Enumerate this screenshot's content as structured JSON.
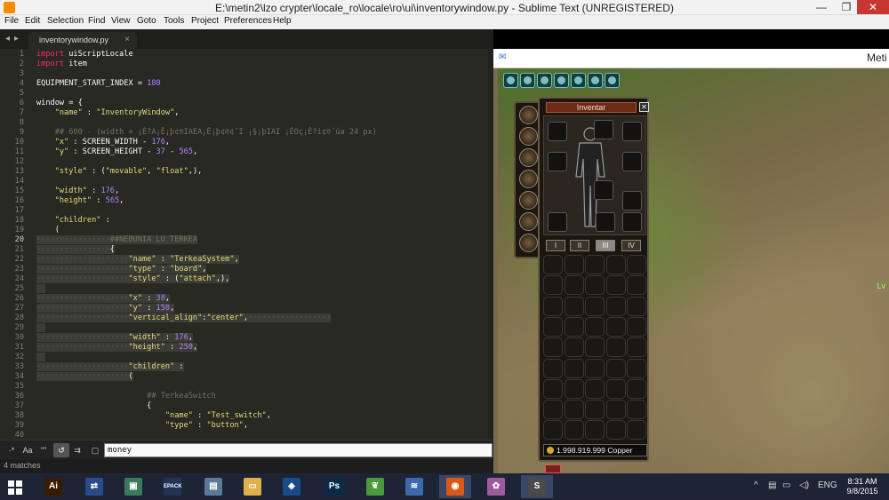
{
  "window": {
    "title": "E:\\metin2\\lzo crypter\\locale_ro\\locale\\ro\\ui\\inventorywindow.py - Sublime Text (UNREGISTERED)",
    "minimize": "—",
    "maximize": "❐",
    "close": "✕"
  },
  "menu": [
    "File",
    "Edit",
    "Selection",
    "Find",
    "View",
    "Goto",
    "Tools",
    "Project",
    "Preferences",
    "Help"
  ],
  "editor": {
    "tab_label": "inventorywindow.py",
    "tab_close": "×",
    "nav_back": "◂",
    "nav_fwd": "▸",
    "lines": [
      {
        "n": "1",
        "parts": [
          [
            "kw",
            "import"
          ],
          [
            "",
            " uiScriptLocale"
          ]
        ]
      },
      {
        "n": "2",
        "parts": [
          [
            "kw",
            "import"
          ],
          [
            "",
            " item"
          ]
        ]
      },
      {
        "n": "3",
        "parts": []
      },
      {
        "n": "4",
        "parts": [
          [
            "",
            "EQUIPMENT_START_INDEX = "
          ],
          [
            "num",
            "180"
          ]
        ]
      },
      {
        "n": "5",
        "parts": []
      },
      {
        "n": "6",
        "parts": [
          [
            "",
            "window = {"
          ]
        ]
      },
      {
        "n": "7",
        "parts": [
          [
            "",
            "    "
          ],
          [
            "str",
            "\"name\""
          ],
          [
            "",
            " : "
          ],
          [
            "str",
            "\"InventoryWindow\""
          ],
          [
            "",
            ","
          ]
        ]
      },
      {
        "n": "8",
        "parts": []
      },
      {
        "n": "9",
        "parts": [
          [
            "cm",
            "    ## 600 - (width + ¡È?A¡Ë¡þ¢®IAEA¡Ë¡þ¢®¢¯I ¡§¡þIAI ¡ÊOç¡Ê?í¢®´úa 24 px)"
          ]
        ]
      },
      {
        "n": "10",
        "parts": [
          [
            "",
            "    "
          ],
          [
            "str",
            "\"x\""
          ],
          [
            "",
            " : SCREEN_WIDTH - "
          ],
          [
            "num",
            "176"
          ],
          [
            "",
            ","
          ]
        ]
      },
      {
        "n": "11",
        "parts": [
          [
            "",
            "    "
          ],
          [
            "str",
            "\"y\""
          ],
          [
            "",
            " : SCREEN_HEIGHT - "
          ],
          [
            "num",
            "37"
          ],
          [
            "",
            " - "
          ],
          [
            "num",
            "565"
          ],
          [
            "",
            ","
          ]
        ]
      },
      {
        "n": "12",
        "parts": []
      },
      {
        "n": "13",
        "parts": [
          [
            "",
            "    "
          ],
          [
            "str",
            "\"style\""
          ],
          [
            "",
            " : ("
          ],
          [
            "str",
            "\"movable\""
          ],
          [
            "",
            ", "
          ],
          [
            "str",
            "\"float\""
          ],
          [
            "",
            ",),"
          ]
        ]
      },
      {
        "n": "14",
        "parts": []
      },
      {
        "n": "15",
        "parts": [
          [
            "",
            "    "
          ],
          [
            "str",
            "\"width\""
          ],
          [
            "",
            " : "
          ],
          [
            "num",
            "176"
          ],
          [
            "",
            ","
          ]
        ]
      },
      {
        "n": "16",
        "parts": [
          [
            "",
            "    "
          ],
          [
            "str",
            "\"height\""
          ],
          [
            "",
            " : "
          ],
          [
            "num",
            "565"
          ],
          [
            "",
            ","
          ]
        ]
      },
      {
        "n": "17",
        "parts": []
      },
      {
        "n": "18",
        "parts": [
          [
            "",
            "    "
          ],
          [
            "str",
            "\"children\""
          ],
          [
            "",
            " :"
          ]
        ]
      },
      {
        "n": "19",
        "parts": [
          [
            "",
            "    ("
          ]
        ]
      },
      {
        "n": "20",
        "hl": true,
        "parts": [
          [
            "dots",
            "················"
          ],
          [
            "cm",
            "##NEBUNIA LU TERKEA"
          ]
        ]
      },
      {
        "n": "21",
        "hl": true,
        "parts": [
          [
            "dots",
            "················"
          ],
          [
            "",
            "{"
          ]
        ]
      },
      {
        "n": "22",
        "hl": true,
        "parts": [
          [
            "dots",
            "····················"
          ],
          [
            "str",
            "\"name\""
          ],
          [
            "",
            " : "
          ],
          [
            "str",
            "\"TerkeaSystem\""
          ],
          [
            "",
            ","
          ]
        ]
      },
      {
        "n": "23",
        "hl": true,
        "parts": [
          [
            "dots",
            "····················"
          ],
          [
            "str",
            "\"type\""
          ],
          [
            "",
            " : "
          ],
          [
            "str",
            "\"board\""
          ],
          [
            "",
            ","
          ]
        ]
      },
      {
        "n": "24",
        "hl": true,
        "parts": [
          [
            "dots",
            "····················"
          ],
          [
            "str",
            "\"style\""
          ],
          [
            "",
            " : ("
          ],
          [
            "str",
            "\"attach\""
          ],
          [
            "",
            ",),"
          ]
        ]
      },
      {
        "n": "25",
        "hl": true,
        "parts": [
          [
            "",
            "  "
          ]
        ]
      },
      {
        "n": "26",
        "hl": true,
        "parts": [
          [
            "dots",
            "····················"
          ],
          [
            "str",
            "\"x\""
          ],
          [
            "",
            " : "
          ],
          [
            "num",
            "38"
          ],
          [
            "",
            ","
          ]
        ]
      },
      {
        "n": "27",
        "hl": true,
        "parts": [
          [
            "dots",
            "····················"
          ],
          [
            "str",
            "\"y\""
          ],
          [
            "",
            " : "
          ],
          [
            "num",
            "150"
          ],
          [
            "",
            ","
          ]
        ]
      },
      {
        "n": "28",
        "hl": true,
        "parts": [
          [
            "dots",
            "····················"
          ],
          [
            "str",
            "\"vertical_align\""
          ],
          [
            "",
            ":"
          ],
          [
            "str",
            "\"center\""
          ],
          [
            "",
            ","
          ],
          [
            "dots",
            "··················"
          ]
        ]
      },
      {
        "n": "29",
        "hl": true,
        "parts": [
          [
            "",
            "  "
          ]
        ]
      },
      {
        "n": "30",
        "hl": true,
        "parts": [
          [
            "dots",
            "····················"
          ],
          [
            "str",
            "\"width\""
          ],
          [
            "",
            " : "
          ],
          [
            "num",
            "176"
          ],
          [
            "",
            ","
          ]
        ]
      },
      {
        "n": "31",
        "hl": true,
        "parts": [
          [
            "dots",
            "····················"
          ],
          [
            "str",
            "\"height\""
          ],
          [
            "",
            " : "
          ],
          [
            "num",
            "250"
          ],
          [
            "",
            ","
          ]
        ]
      },
      {
        "n": "32",
        "hl": true,
        "parts": [
          [
            "",
            "  "
          ]
        ]
      },
      {
        "n": "33",
        "hl": true,
        "parts": [
          [
            "dots",
            "····················"
          ],
          [
            "str",
            "\"children\""
          ],
          [
            "",
            " :"
          ]
        ]
      },
      {
        "n": "34",
        "hl": true,
        "parts": [
          [
            "dots",
            "····················"
          ],
          [
            "",
            "("
          ]
        ]
      },
      {
        "n": "35",
        "parts": []
      },
      {
        "n": "36",
        "parts": [
          [
            "cm",
            "                        ## TerkeaSwitch"
          ]
        ]
      },
      {
        "n": "37",
        "parts": [
          [
            "",
            "                        {"
          ]
        ]
      },
      {
        "n": "38",
        "parts": [
          [
            "",
            "                            "
          ],
          [
            "str",
            "\"name\""
          ],
          [
            "",
            " : "
          ],
          [
            "str",
            "\"Test_switch\""
          ],
          [
            "",
            ","
          ]
        ]
      },
      {
        "n": "39",
        "parts": [
          [
            "",
            "                            "
          ],
          [
            "str",
            "\"type\""
          ],
          [
            "",
            " : "
          ],
          [
            "str",
            "\"button\""
          ],
          [
            "",
            ","
          ]
        ]
      },
      {
        "n": "40",
        "parts": []
      }
    ],
    "current_line": "20"
  },
  "find": {
    "options": [
      {
        "label": "·*",
        "on": false
      },
      {
        "label": "Aa",
        "on": false
      },
      {
        "label": "“”",
        "on": false
      },
      {
        "label": "↺",
        "on": true
      },
      {
        "label": "⇉",
        "on": false
      },
      {
        "label": "▢",
        "on": false
      }
    ],
    "query": "money"
  },
  "status": {
    "text": "4 matches"
  },
  "game": {
    "title": "Meti",
    "icon": "✉",
    "side_text": "Lv",
    "inventory": {
      "title": "Inventar",
      "close": "✕",
      "pages": [
        "I",
        "II",
        "III",
        "IV"
      ],
      "active_page": 2,
      "money": "1.998.919.999 Copper"
    }
  },
  "taskbar": {
    "apps": [
      {
        "name": "windows-start",
        "label": "",
        "color": "#1d2436"
      },
      {
        "name": "illustrator",
        "label": "Ai",
        "color": "#3a1a00"
      },
      {
        "name": "network-tool",
        "label": "⇄",
        "color": "#2a4a8a"
      },
      {
        "name": "app-generic",
        "label": "▣",
        "color": "#3a7a5a"
      },
      {
        "name": "epack",
        "label": "EPACK",
        "color": "#223355"
      },
      {
        "name": "app-window",
        "label": "▤",
        "color": "#5a7a9a"
      },
      {
        "name": "file-explorer",
        "label": "▭",
        "color": "#e0b04a"
      },
      {
        "name": "virtualbox",
        "label": "◈",
        "color": "#1a4a8a"
      },
      {
        "name": "photoshop",
        "label": "Ps",
        "color": "#0a2a4a"
      },
      {
        "name": "app-leaf",
        "label": "❦",
        "color": "#4a9a3a"
      },
      {
        "name": "app-wave",
        "label": "≋",
        "color": "#3a6aaa"
      },
      {
        "name": "firefox",
        "label": "◉",
        "color": "#d85a1a"
      },
      {
        "name": "app-butterfly",
        "label": "✿",
        "color": "#a05aa0"
      },
      {
        "name": "sublime-text",
        "label": "S",
        "color": "#4a4a4a"
      }
    ],
    "tray": [
      "^",
      "▤",
      "▭",
      "◁)",
      "ENG"
    ],
    "time": "8:31 AM",
    "date": "9/8/2015"
  }
}
